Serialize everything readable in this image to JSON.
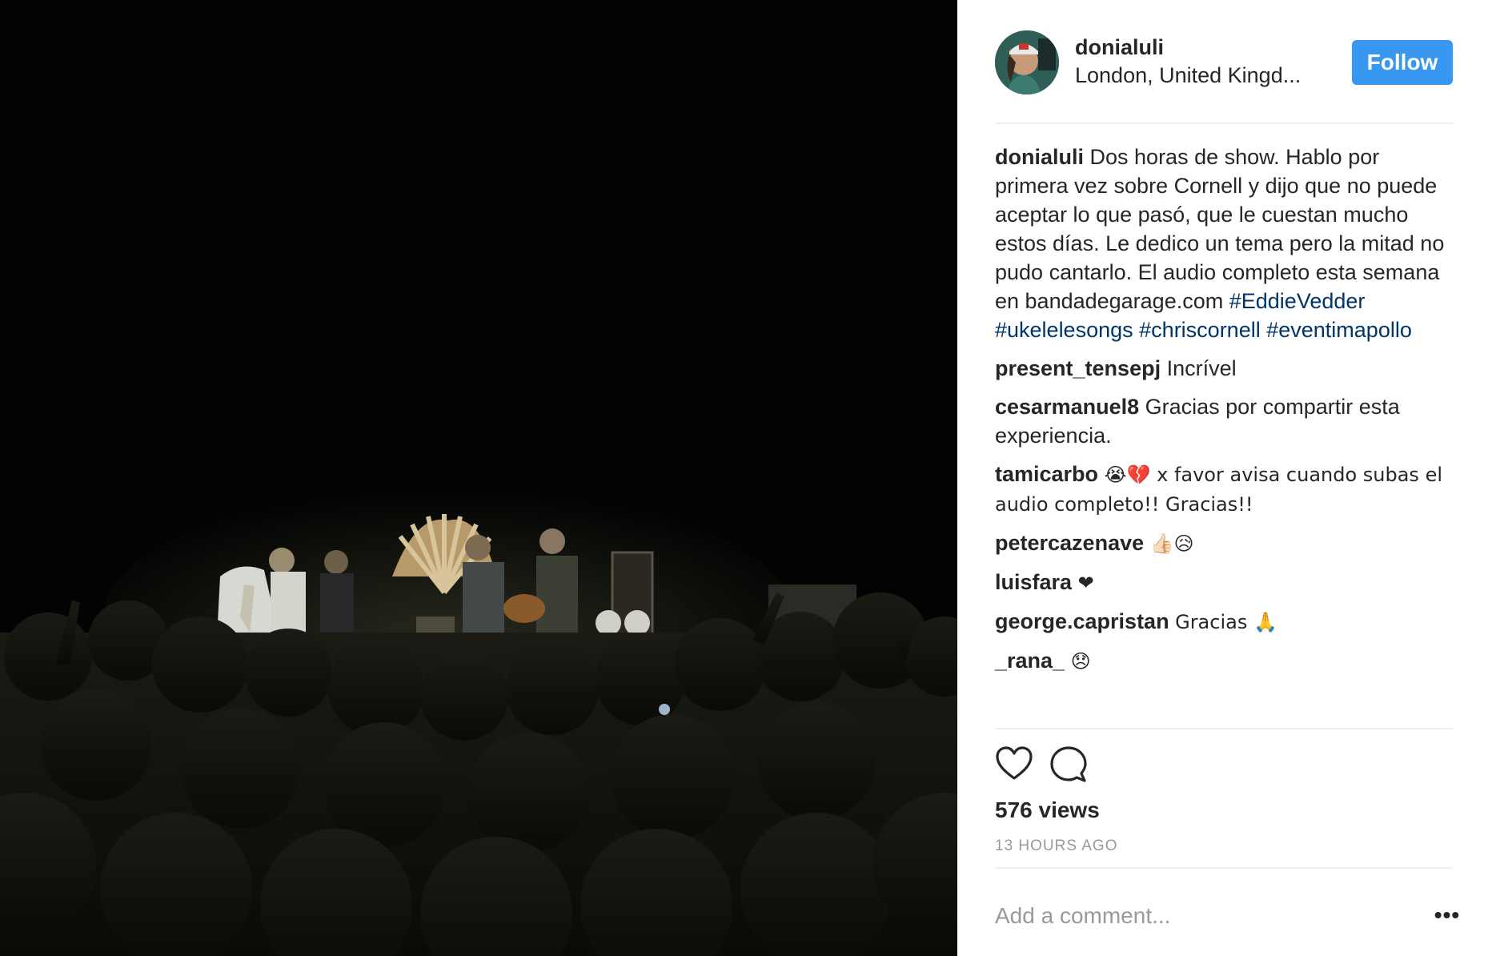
{
  "post": {
    "views": "576 views",
    "timestamp": "13 HOURS AGO"
  },
  "header": {
    "username": "donialuli",
    "location": "London, United Kingd...",
    "follow_label": "Follow"
  },
  "caption": {
    "author": "donialuli",
    "text": "Dos horas de show. Hablo por primera vez sobre Cornell y dijo que no puede aceptar lo que pasó, que le cuestan mucho estos días. Le dedico un tema pero la mitad no pudo cantarlo. El audio completo esta semana en bandadegarage.com",
    "hashtags": [
      "#EddieVedder",
      "#ukelelesongs",
      "#chriscornell",
      "#eventimapollo"
    ]
  },
  "comments": [
    {
      "author": "present_tensepj",
      "text": "Incrível"
    },
    {
      "author": "cesarmanuel8",
      "text": "Gracias por compartir esta experiencia."
    },
    {
      "author": "tamicarbo",
      "text": "😭💔 x favor avisa cuando subas el audio completo!! Gracias!!"
    },
    {
      "author": "petercazenave",
      "text": "👍🏻😥"
    },
    {
      "author": "luisfara",
      "text": "❤"
    },
    {
      "author": "george.capristan",
      "text": "Gracias 🙏"
    },
    {
      "author": "_rana_",
      "text": "😞"
    }
  ],
  "comment_box": {
    "placeholder": "Add a comment...",
    "more_label": "•••"
  },
  "icons": {
    "like": "heart-icon",
    "comment": "speech-bubble-icon",
    "more": "ellipsis-icon"
  },
  "colors": {
    "follow_button": "#3897f0",
    "hashtag": "#003569",
    "timestamp": "#999999"
  }
}
